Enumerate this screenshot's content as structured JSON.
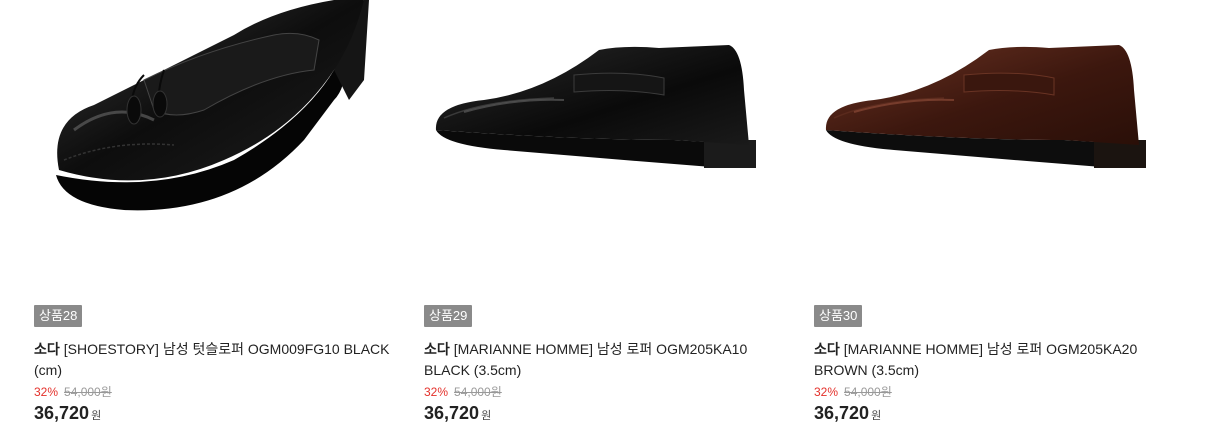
{
  "products": [
    {
      "badge": "상품28",
      "brand": "소다",
      "name": "[SHOESTORY] 남성 텃슬로퍼 OGM009FG10 BLACK (cm)",
      "discount": "32%",
      "original_price": "54,000원",
      "sale_price": "36,720",
      "currency": "원",
      "image_icon": "black-tassel-loafer-image"
    },
    {
      "badge": "상품29",
      "brand": "소다",
      "name": "[MARIANNE HOMME] 남성 로퍼 OGM205KA10 BLACK (3.5cm)",
      "discount": "32%",
      "original_price": "54,000원",
      "sale_price": "36,720",
      "currency": "원",
      "image_icon": "black-penny-loafer-image"
    },
    {
      "badge": "상품30",
      "brand": "소다",
      "name": "[MARIANNE HOMME] 남성 로퍼 OGM205KA20 BROWN (3.5cm)",
      "discount": "32%",
      "original_price": "54,000원",
      "sale_price": "36,720",
      "currency": "원",
      "image_icon": "brown-penny-loafer-image"
    }
  ],
  "colors": {
    "badge_bg": "#8a8a8a",
    "discount": "#e4312b",
    "shoe_black": "#111111",
    "shoe_brown": "#4a1f14"
  }
}
